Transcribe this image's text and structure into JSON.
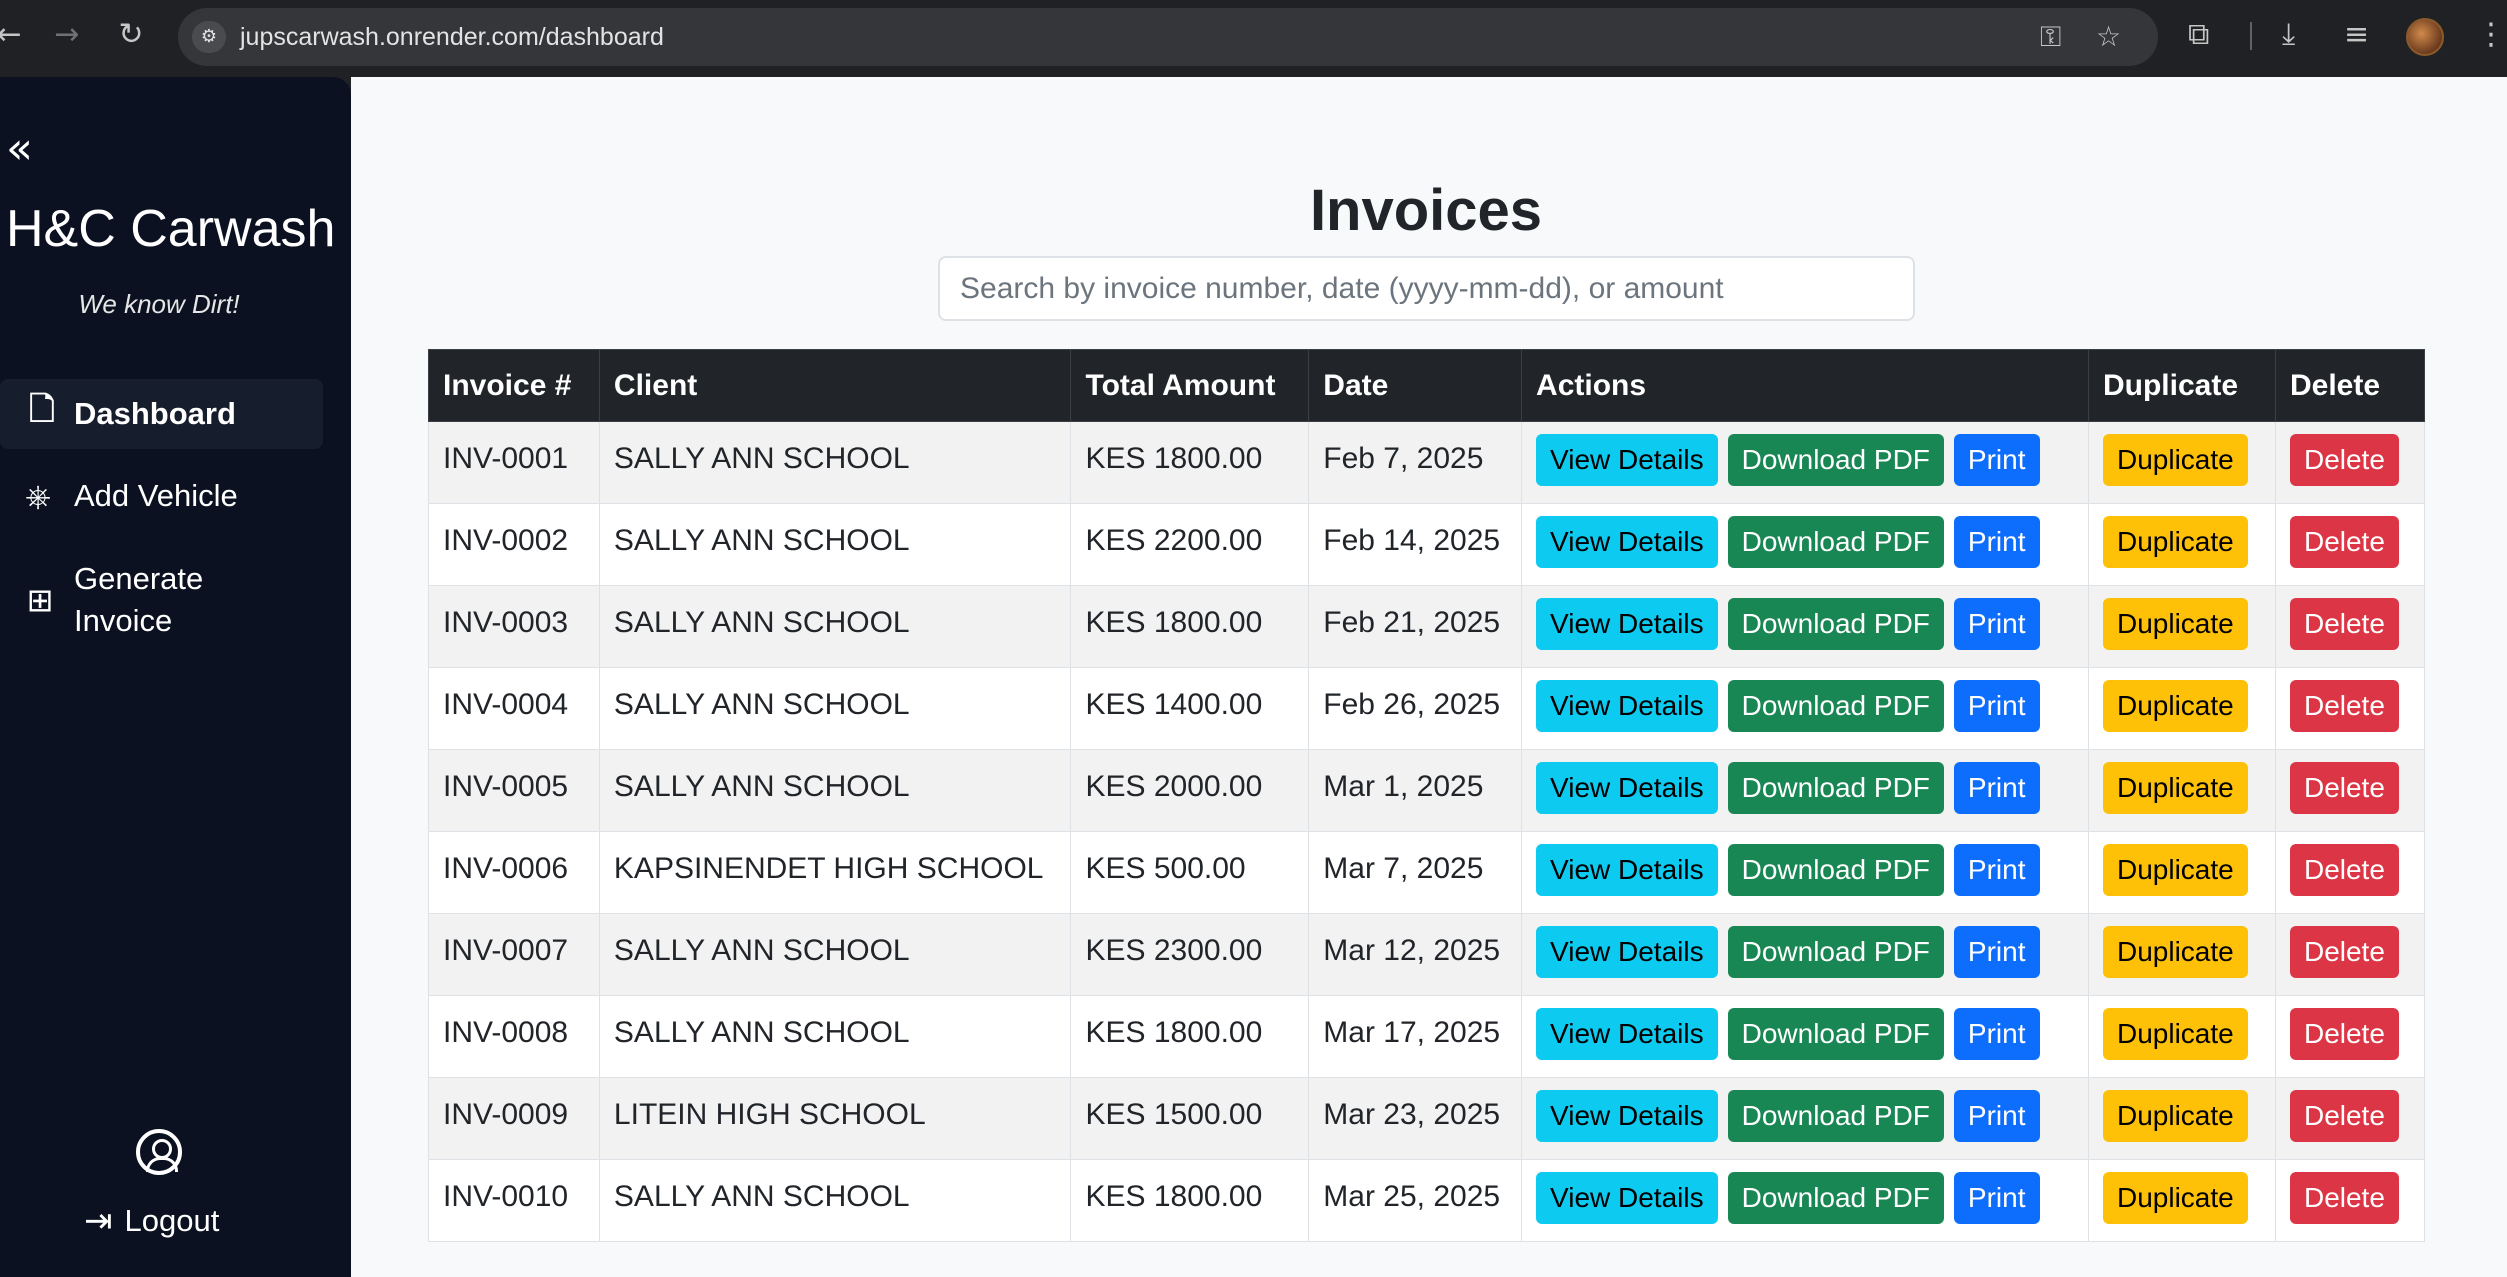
{
  "browser": {
    "url": "jupscarwash.onrender.com/dashboard",
    "icons": [
      "back-icon",
      "forward-icon",
      "reload-icon",
      "site-settings-icon",
      "password-key-icon",
      "bookmark-star-icon",
      "extensions-icon",
      "download-icon",
      "media-control-icon",
      "profile-avatar-icon",
      "menu-icon"
    ]
  },
  "sidebar": {
    "collapse_glyph": "«",
    "brand": "H&C Carwash",
    "tagline": "We know Dirt!",
    "items": [
      {
        "label": "Dashboard",
        "icon": "document-icon",
        "active": true
      },
      {
        "label": "Add Vehicle",
        "icon": "steering-wheel-icon",
        "active": false
      },
      {
        "label": "Generate Invoice",
        "icon": "file-plus-icon",
        "active": false
      }
    ],
    "logout_label": "Logout"
  },
  "main": {
    "title": "Invoices",
    "search_placeholder": "Search by invoice number, date (yyyy-mm-dd), or amount",
    "columns": [
      "Invoice #",
      "Client",
      "Total Amount",
      "Date",
      "Actions",
      "Duplicate",
      "Delete"
    ],
    "buttons": {
      "view": "View Details",
      "download": "Download PDF",
      "print": "Print",
      "duplicate": "Duplicate",
      "delete": "Delete"
    },
    "rows": [
      {
        "invoice": "INV-0001",
        "client": "SALLY ANN SCHOOL",
        "amount": "KES 1800.00",
        "date": "Feb 7, 2025"
      },
      {
        "invoice": "INV-0002",
        "client": "SALLY ANN SCHOOL",
        "amount": "KES 2200.00",
        "date": "Feb 14, 2025"
      },
      {
        "invoice": "INV-0003",
        "client": "SALLY ANN SCHOOL",
        "amount": "KES 1800.00",
        "date": "Feb 21, 2025"
      },
      {
        "invoice": "INV-0004",
        "client": "SALLY ANN SCHOOL",
        "amount": "KES 1400.00",
        "date": "Feb 26, 2025"
      },
      {
        "invoice": "INV-0005",
        "client": "SALLY ANN SCHOOL",
        "amount": "KES 2000.00",
        "date": "Mar 1, 2025"
      },
      {
        "invoice": "INV-0006",
        "client": "KAPSINENDET HIGH SCHOOL",
        "amount": "KES 500.00",
        "date": "Mar 7, 2025"
      },
      {
        "invoice": "INV-0007",
        "client": "SALLY ANN SCHOOL",
        "amount": "KES 2300.00",
        "date": "Mar 12, 2025"
      },
      {
        "invoice": "INV-0008",
        "client": "SALLY ANN SCHOOL",
        "amount": "KES 1800.00",
        "date": "Mar 17, 2025"
      },
      {
        "invoice": "INV-0009",
        "client": "LITEIN HIGH SCHOOL",
        "amount": "KES 1500.00",
        "date": "Mar 23, 2025"
      },
      {
        "invoice": "INV-0010",
        "client": "SALLY ANN SCHOOL",
        "amount": "KES 1800.00",
        "date": "Mar 25, 2025"
      }
    ]
  },
  "colors": {
    "sidebar_bg": "#0b1120",
    "table_header_bg": "#212529",
    "info": "#0dcaf0",
    "success": "#198754",
    "primary": "#0d6efd",
    "warning": "#ffc107",
    "danger": "#dc3545"
  }
}
